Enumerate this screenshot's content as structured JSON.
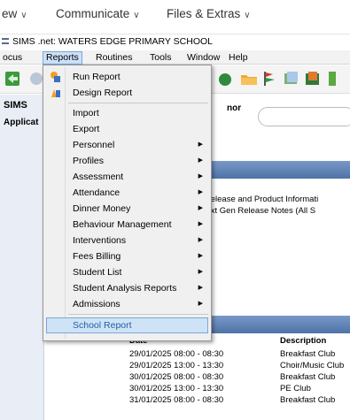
{
  "top_nav": {
    "items": [
      {
        "label": "ew"
      },
      {
        "label": "Communicate"
      },
      {
        "label": "Files & Extras"
      }
    ]
  },
  "window": {
    "title": "SIMS .net: WATERS EDGE PRIMARY SCHOOL"
  },
  "menubar": {
    "items": [
      {
        "label": "ocus"
      },
      {
        "label": "Reports"
      },
      {
        "label": "Routines"
      },
      {
        "label": "Tools"
      },
      {
        "label": "Window"
      },
      {
        "label": "Help"
      }
    ],
    "active": "Reports"
  },
  "left_panel": {
    "title": "SIMS",
    "subtitle": "Applicat"
  },
  "main": {
    "partial_label": "nor",
    "info_heading": "le",
    "info_lines": [
      "IS7 Release and Product Informati",
      "IS Next Gen Release Notes (All S"
    ],
    "table": {
      "headers": {
        "date": "Date",
        "description": "Description"
      },
      "rows": [
        {
          "date": "29/01/2025 08:00 - 08:30",
          "description": "Breakfast Club"
        },
        {
          "date": "29/01/2025 13:00 - 13:30",
          "description": "Choir/Music Club"
        },
        {
          "date": "30/01/2025 08:00 - 08:30",
          "description": "Breakfast Club"
        },
        {
          "date": "30/01/2025 13:00 - 13:30",
          "description": "PE Club"
        },
        {
          "date": "31/01/2025 08:00 - 08:30",
          "description": "Breakfast Club"
        }
      ]
    }
  },
  "reports_menu": {
    "items": [
      {
        "label": "Run Report",
        "icon": "run-report-icon",
        "submenu": false
      },
      {
        "label": "Design Report",
        "icon": "design-report-icon",
        "submenu": false
      },
      {
        "label": "Import",
        "submenu": false
      },
      {
        "label": "Export",
        "submenu": false
      },
      {
        "label": "Personnel",
        "submenu": true
      },
      {
        "label": "Profiles",
        "submenu": true
      },
      {
        "label": "Assessment",
        "submenu": true
      },
      {
        "label": "Attendance",
        "submenu": true
      },
      {
        "label": "Dinner Money",
        "submenu": true
      },
      {
        "label": "Behaviour Management",
        "submenu": true
      },
      {
        "label": "Interventions",
        "submenu": true
      },
      {
        "label": "Fees Billing",
        "submenu": true
      },
      {
        "label": "Student List",
        "submenu": true
      },
      {
        "label": "Student Analysis Reports",
        "submenu": true
      },
      {
        "label": "Admissions",
        "submenu": true
      },
      {
        "label": "School Report",
        "submenu": false
      }
    ],
    "highlighted": "School Report",
    "arrow_glyph": "▶"
  },
  "colors": {
    "menu_bg": "#f0f0f0",
    "highlight_bg": "#cfe3f7",
    "highlight_border": "#7ca7d8",
    "section_header": "#5a7db3"
  }
}
